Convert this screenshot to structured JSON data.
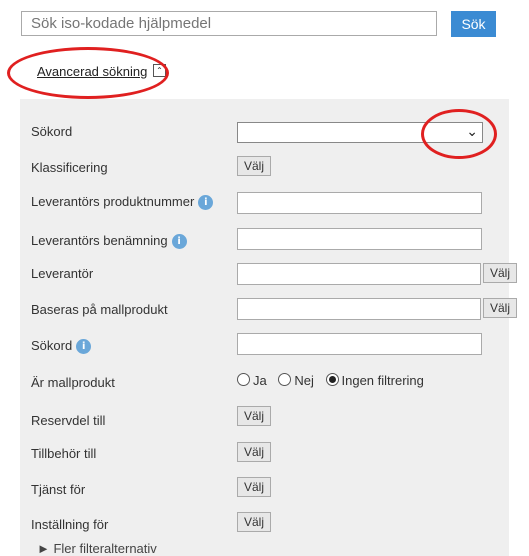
{
  "search": {
    "placeholder": "Sök iso-kodade hjälpmedel",
    "button_label": "Sök"
  },
  "advanced": {
    "link_label": "Avancerad sökning",
    "toggle_symbol": "⌃"
  },
  "form": {
    "sokord_select_label": "Sökord",
    "klassificering_label": "Klassificering",
    "lev_produktnummer_label": "Leverantörs produktnummer",
    "lev_benamning_label": "Leverantörs benämning",
    "leverantor_label": "Leverantör",
    "baseras_label": "Baseras på mallprodukt",
    "sokord_label": "Sökord",
    "mallprodukt_label": "Är mallprodukt",
    "reservdel_label": "Reservdel till",
    "tillbehor_label": "Tillbehör till",
    "tjanst_label": "Tjänst för",
    "installning_label": "Inställning för",
    "valj_label": "Välj",
    "radio": {
      "ja": "Ja",
      "nej": "Nej",
      "ingen": "Ingen filtrering"
    },
    "more_filters": "► Fler filteralternativ"
  },
  "annotation_color": "#e02020"
}
